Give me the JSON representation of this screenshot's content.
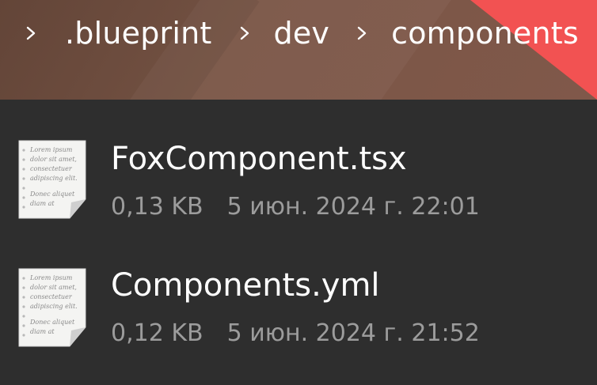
{
  "header": {
    "breadcrumb": [
      {
        "label": ".blueprint"
      },
      {
        "label": "dev"
      },
      {
        "label": "components"
      }
    ],
    "accent_color": "#f25252",
    "background_color": "#7a5646"
  },
  "files": [
    {
      "name": "FoxComponent.tsx",
      "size": "0,13 KB",
      "date": "5 июн. 2024 г. 22:01",
      "icon": "text-document-icon"
    },
    {
      "name": "Components.yml",
      "size": "0,12 KB",
      "date": "5 июн. 2024 г. 21:52",
      "icon": "text-document-icon"
    }
  ],
  "thumbnail_text": [
    "Lorem ipsum",
    "dolor sit amet,",
    "consectetuer",
    "adipiscing elit.",
    "Donec aliquet",
    "diam at"
  ]
}
